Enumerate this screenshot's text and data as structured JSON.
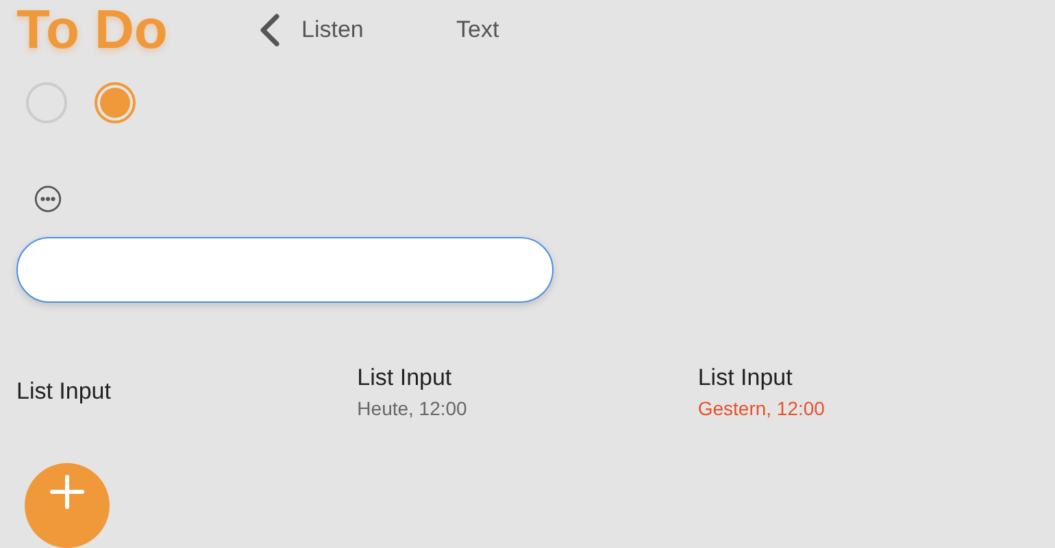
{
  "header": {
    "title": "To Do",
    "back_label": "Listen",
    "link": "Text"
  },
  "radios": [
    {
      "selected": false
    },
    {
      "selected": true
    }
  ],
  "list_items": [
    {
      "title": "List Input"
    },
    {
      "title": "List Input",
      "date": "Heute, 12:00",
      "overdue": false
    },
    {
      "title": "List Input",
      "date": "Gestern, 12:00",
      "overdue": true
    }
  ]
}
